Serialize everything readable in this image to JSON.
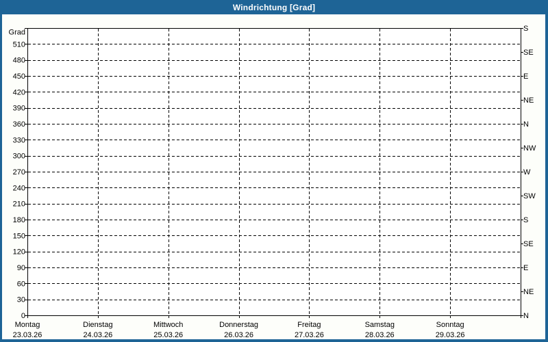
{
  "window": {
    "title": "Windrichtung [Grad]"
  },
  "colors": {
    "frame": "#1E6496",
    "title_text": "#FFFFFF",
    "background": "#FDFEFA",
    "plot_bg": "#FFFFFF",
    "axis": "#000000",
    "grid": "#000000",
    "label": "#000000"
  },
  "chart_data": {
    "type": "line",
    "title": "Windrichtung [Grad]",
    "grid": "dashed",
    "legend": "none",
    "y_axis_left": {
      "title": "Grad",
      "min": 0,
      "max": 540,
      "grid_step": 30,
      "tick_labels": [
        "0",
        "30",
        "60",
        "90",
        "120",
        "150",
        "180",
        "210",
        "240",
        "270",
        "300",
        "330",
        "360",
        "390",
        "420",
        "450",
        "480",
        "510"
      ]
    },
    "y_axis_right": {
      "unit": "compass",
      "min": 0,
      "max": 540,
      "tick_step": 45,
      "tick_labels": [
        "N",
        "NE",
        "E",
        "SE",
        "S",
        "SW",
        "W",
        "NW",
        "N",
        "NE",
        "E",
        "SE",
        "S"
      ]
    },
    "x_axis": {
      "num_days": 7,
      "days": [
        {
          "weekday": "Montag",
          "date": "23.03.26"
        },
        {
          "weekday": "Dienstag",
          "date": "24.03.26"
        },
        {
          "weekday": "Mittwoch",
          "date": "25.03.26"
        },
        {
          "weekday": "Donnerstag",
          "date": "26.03.26"
        },
        {
          "weekday": "Freitag",
          "date": "27.03.26"
        },
        {
          "weekday": "Samstag",
          "date": "28.03.26"
        },
        {
          "weekday": "Sonntag",
          "date": "29.03.26"
        }
      ]
    },
    "series": []
  }
}
